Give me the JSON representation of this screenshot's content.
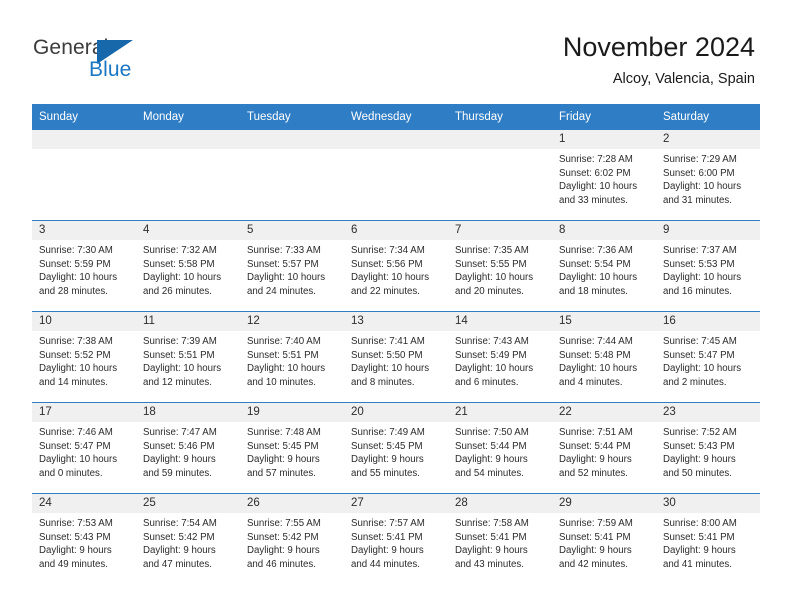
{
  "brand": {
    "name_part1": "General",
    "name_part2": "Blue",
    "triangle_color": "#1767ab",
    "blue_color": "#1b76c3"
  },
  "header": {
    "title": "November 2024",
    "location": "Alcoy, Valencia, Spain",
    "accent_color": "#2f7dc4"
  },
  "calendar": {
    "day_headers": [
      "Sunday",
      "Monday",
      "Tuesday",
      "Wednesday",
      "Thursday",
      "Friday",
      "Saturday"
    ],
    "labels": {
      "sunrise": "Sunrise:",
      "sunset": "Sunset:",
      "daylight": "Daylight:"
    },
    "weeks": [
      [
        {
          "day": "",
          "blank": true
        },
        {
          "day": "",
          "blank": true
        },
        {
          "day": "",
          "blank": true
        },
        {
          "day": "",
          "blank": true
        },
        {
          "day": "",
          "blank": true
        },
        {
          "day": "1",
          "sunrise": "Sunrise: 7:28 AM",
          "sunset": "Sunset: 6:02 PM",
          "daylight1": "Daylight: 10 hours",
          "daylight2": "and 33 minutes."
        },
        {
          "day": "2",
          "sunrise": "Sunrise: 7:29 AM",
          "sunset": "Sunset: 6:00 PM",
          "daylight1": "Daylight: 10 hours",
          "daylight2": "and 31 minutes."
        }
      ],
      [
        {
          "day": "3",
          "sunrise": "Sunrise: 7:30 AM",
          "sunset": "Sunset: 5:59 PM",
          "daylight1": "Daylight: 10 hours",
          "daylight2": "and 28 minutes."
        },
        {
          "day": "4",
          "sunrise": "Sunrise: 7:32 AM",
          "sunset": "Sunset: 5:58 PM",
          "daylight1": "Daylight: 10 hours",
          "daylight2": "and 26 minutes."
        },
        {
          "day": "5",
          "sunrise": "Sunrise: 7:33 AM",
          "sunset": "Sunset: 5:57 PM",
          "daylight1": "Daylight: 10 hours",
          "daylight2": "and 24 minutes."
        },
        {
          "day": "6",
          "sunrise": "Sunrise: 7:34 AM",
          "sunset": "Sunset: 5:56 PM",
          "daylight1": "Daylight: 10 hours",
          "daylight2": "and 22 minutes."
        },
        {
          "day": "7",
          "sunrise": "Sunrise: 7:35 AM",
          "sunset": "Sunset: 5:55 PM",
          "daylight1": "Daylight: 10 hours",
          "daylight2": "and 20 minutes."
        },
        {
          "day": "8",
          "sunrise": "Sunrise: 7:36 AM",
          "sunset": "Sunset: 5:54 PM",
          "daylight1": "Daylight: 10 hours",
          "daylight2": "and 18 minutes."
        },
        {
          "day": "9",
          "sunrise": "Sunrise: 7:37 AM",
          "sunset": "Sunset: 5:53 PM",
          "daylight1": "Daylight: 10 hours",
          "daylight2": "and 16 minutes."
        }
      ],
      [
        {
          "day": "10",
          "sunrise": "Sunrise: 7:38 AM",
          "sunset": "Sunset: 5:52 PM",
          "daylight1": "Daylight: 10 hours",
          "daylight2": "and 14 minutes."
        },
        {
          "day": "11",
          "sunrise": "Sunrise: 7:39 AM",
          "sunset": "Sunset: 5:51 PM",
          "daylight1": "Daylight: 10 hours",
          "daylight2": "and 12 minutes."
        },
        {
          "day": "12",
          "sunrise": "Sunrise: 7:40 AM",
          "sunset": "Sunset: 5:51 PM",
          "daylight1": "Daylight: 10 hours",
          "daylight2": "and 10 minutes."
        },
        {
          "day": "13",
          "sunrise": "Sunrise: 7:41 AM",
          "sunset": "Sunset: 5:50 PM",
          "daylight1": "Daylight: 10 hours",
          "daylight2": "and 8 minutes."
        },
        {
          "day": "14",
          "sunrise": "Sunrise: 7:43 AM",
          "sunset": "Sunset: 5:49 PM",
          "daylight1": "Daylight: 10 hours",
          "daylight2": "and 6 minutes."
        },
        {
          "day": "15",
          "sunrise": "Sunrise: 7:44 AM",
          "sunset": "Sunset: 5:48 PM",
          "daylight1": "Daylight: 10 hours",
          "daylight2": "and 4 minutes."
        },
        {
          "day": "16",
          "sunrise": "Sunrise: 7:45 AM",
          "sunset": "Sunset: 5:47 PM",
          "daylight1": "Daylight: 10 hours",
          "daylight2": "and 2 minutes."
        }
      ],
      [
        {
          "day": "17",
          "sunrise": "Sunrise: 7:46 AM",
          "sunset": "Sunset: 5:47 PM",
          "daylight1": "Daylight: 10 hours",
          "daylight2": "and 0 minutes."
        },
        {
          "day": "18",
          "sunrise": "Sunrise: 7:47 AM",
          "sunset": "Sunset: 5:46 PM",
          "daylight1": "Daylight: 9 hours",
          "daylight2": "and 59 minutes."
        },
        {
          "day": "19",
          "sunrise": "Sunrise: 7:48 AM",
          "sunset": "Sunset: 5:45 PM",
          "daylight1": "Daylight: 9 hours",
          "daylight2": "and 57 minutes."
        },
        {
          "day": "20",
          "sunrise": "Sunrise: 7:49 AM",
          "sunset": "Sunset: 5:45 PM",
          "daylight1": "Daylight: 9 hours",
          "daylight2": "and 55 minutes."
        },
        {
          "day": "21",
          "sunrise": "Sunrise: 7:50 AM",
          "sunset": "Sunset: 5:44 PM",
          "daylight1": "Daylight: 9 hours",
          "daylight2": "and 54 minutes."
        },
        {
          "day": "22",
          "sunrise": "Sunrise: 7:51 AM",
          "sunset": "Sunset: 5:44 PM",
          "daylight1": "Daylight: 9 hours",
          "daylight2": "and 52 minutes."
        },
        {
          "day": "23",
          "sunrise": "Sunrise: 7:52 AM",
          "sunset": "Sunset: 5:43 PM",
          "daylight1": "Daylight: 9 hours",
          "daylight2": "and 50 minutes."
        }
      ],
      [
        {
          "day": "24",
          "sunrise": "Sunrise: 7:53 AM",
          "sunset": "Sunset: 5:43 PM",
          "daylight1": "Daylight: 9 hours",
          "daylight2": "and 49 minutes."
        },
        {
          "day": "25",
          "sunrise": "Sunrise: 7:54 AM",
          "sunset": "Sunset: 5:42 PM",
          "daylight1": "Daylight: 9 hours",
          "daylight2": "and 47 minutes."
        },
        {
          "day": "26",
          "sunrise": "Sunrise: 7:55 AM",
          "sunset": "Sunset: 5:42 PM",
          "daylight1": "Daylight: 9 hours",
          "daylight2": "and 46 minutes."
        },
        {
          "day": "27",
          "sunrise": "Sunrise: 7:57 AM",
          "sunset": "Sunset: 5:41 PM",
          "daylight1": "Daylight: 9 hours",
          "daylight2": "and 44 minutes."
        },
        {
          "day": "28",
          "sunrise": "Sunrise: 7:58 AM",
          "sunset": "Sunset: 5:41 PM",
          "daylight1": "Daylight: 9 hours",
          "daylight2": "and 43 minutes."
        },
        {
          "day": "29",
          "sunrise": "Sunrise: 7:59 AM",
          "sunset": "Sunset: 5:41 PM",
          "daylight1": "Daylight: 9 hours",
          "daylight2": "and 42 minutes."
        },
        {
          "day": "30",
          "sunrise": "Sunrise: 8:00 AM",
          "sunset": "Sunset: 5:41 PM",
          "daylight1": "Daylight: 9 hours",
          "daylight2": "and 41 minutes."
        }
      ]
    ]
  }
}
